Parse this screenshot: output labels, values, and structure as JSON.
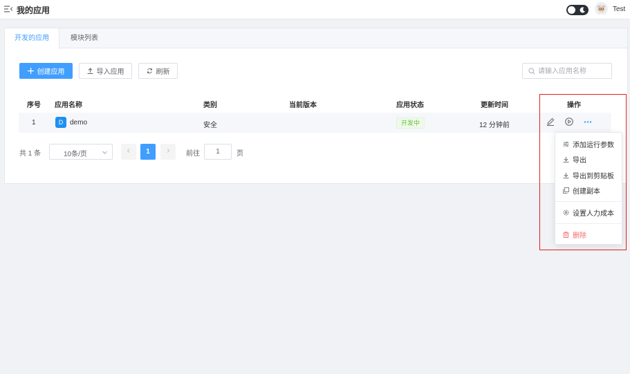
{
  "header": {
    "title": "我的应用",
    "username": "Test"
  },
  "tabs": [
    {
      "label": "开发的应用",
      "active": true
    },
    {
      "label": "模块列表",
      "active": false
    }
  ],
  "toolbar": {
    "create_label": "创建应用",
    "import_label": "导入应用",
    "refresh_label": "刷新",
    "search_placeholder": "请输入应用名称"
  },
  "table": {
    "columns": [
      "序号",
      "应用名称",
      "类别",
      "当前版本",
      "应用状态",
      "更新时间",
      "操作"
    ],
    "rows": [
      {
        "index": "1",
        "icon_letter": "D",
        "name": "demo",
        "category": "安全",
        "version": "",
        "status": "开发中",
        "updated": "12 分钟前"
      }
    ]
  },
  "pagination": {
    "total": "共 1 条",
    "page_size": "10条/页",
    "current_page": "1",
    "goto_label": "前往",
    "goto_value": "1",
    "page_unit": "页"
  },
  "dropdown": {
    "items": [
      {
        "label": "添加运行参数",
        "icon": "sliders-icon"
      },
      {
        "label": "导出",
        "icon": "download-icon"
      },
      {
        "label": "导出到剪贴板",
        "icon": "download-icon"
      },
      {
        "label": "创建副本",
        "icon": "copy-icon"
      },
      {
        "label": "设置人力成本",
        "icon": "gear-icon"
      },
      {
        "label": "删除",
        "icon": "trash-icon",
        "danger": true
      }
    ]
  },
  "colors": {
    "primary": "#409eff",
    "success": "#67c23a",
    "danger": "#f56c6c",
    "highlight": "#e02020"
  }
}
